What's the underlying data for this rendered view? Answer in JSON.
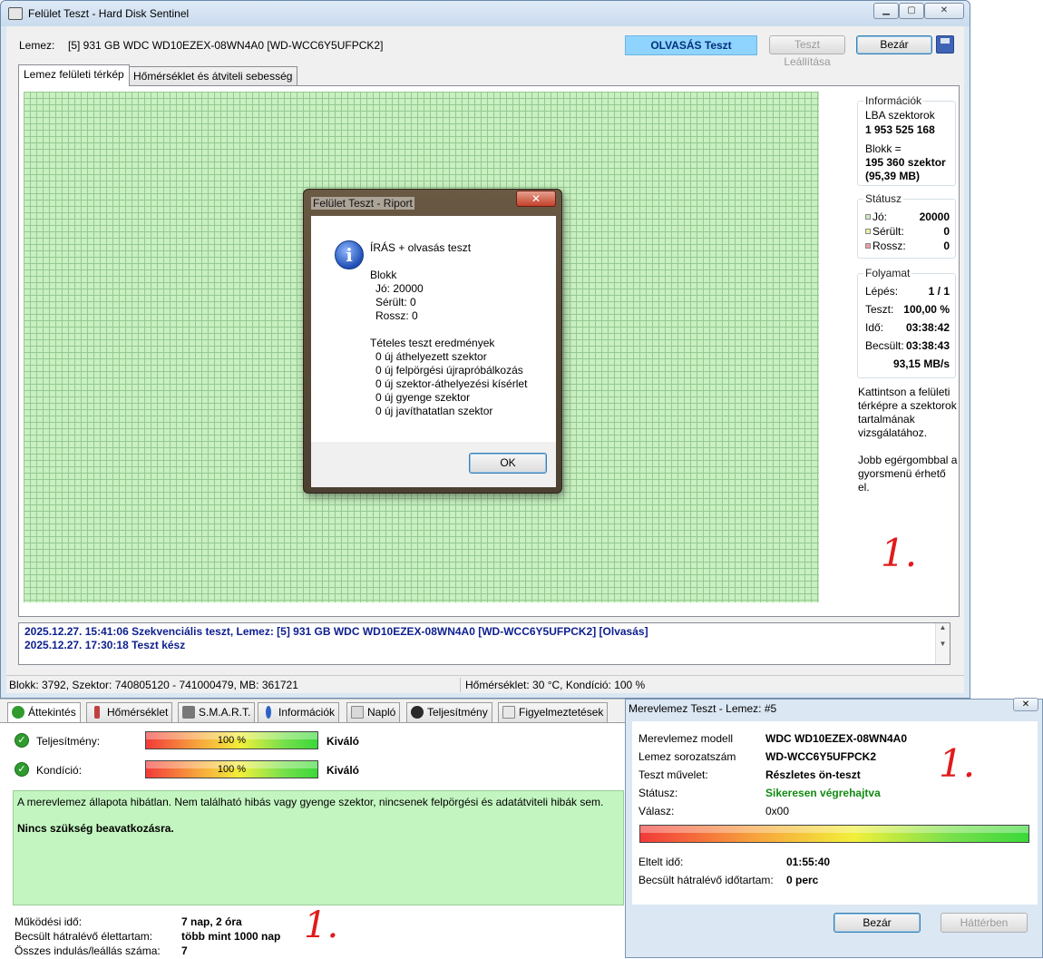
{
  "main_window": {
    "title": "Felület Teszt - Hard Disk Sentinel",
    "disk_label": "Lemez:",
    "disk_name": "[5] 931 GB  WDC WD10EZEX-08WN4A0 [WD-WCC6Y5UFPCK2]",
    "test_mode_badge": "OLVASÁS Teszt",
    "stop_button": "Teszt Leállítása",
    "close_button": "Bezár",
    "tabs": [
      "Lemez felületi térkép",
      "Hőmérséklet és átviteli sebesség"
    ],
    "info_group": {
      "title": "Információk",
      "lba_label": "LBA szektorok",
      "lba_value": "1 953 525 168",
      "block_label": "Blokk =",
      "block_value": "195 360 szektor",
      "block_mb": "(95,39 MB)"
    },
    "status_group": {
      "title": "Státusz",
      "good_label": "Jó:",
      "good_value": "20000",
      "damaged_label": "Sérült:",
      "damaged_value": "0",
      "bad_label": "Rossz:",
      "bad_value": "0",
      "colors": {
        "good": "#c8f0c0",
        "damaged": "#f0f0a0",
        "bad": "#f0a0a0"
      }
    },
    "progress_group": {
      "title": "Folyamat",
      "step_label": "Lépés:",
      "step_value": "1 / 1",
      "test_label": "Teszt:",
      "test_value": "100,00 %",
      "time_label": "Idő:",
      "time_value": "03:38:42",
      "estimated_label": "Becsült:",
      "estimated_value": "03:38:43",
      "speed_value": "93,15 MB/s"
    },
    "note_1": "Kattintson a felületi térképre a szektorok tartalmának vizsgálatához.",
    "note_2": "Jobb egérgombbal a gyorsmenü érhető el.",
    "log_lines": [
      "2025.12.27.  15:41:06   Szekvenciális teszt, Lemez: [5] 931 GB  WDC WD10EZEX-08WN4A0 [WD-WCC6Y5UFPCK2] [Olvasás]",
      "2025.12.27.  17:30:18   Teszt kész"
    ],
    "statusbar_left": "Blokk: 3792, Szektor: 740805120 - 741000479, MB: 361721",
    "statusbar_right": "Hőmérséklet: 30  °C,  Kondíció: 100 %"
  },
  "report_dialog": {
    "title": "Felület Teszt - Riport",
    "lines": [
      "ÍRÁS + olvasás teszt",
      "Blokk",
      "  Jó: 20000",
      "  Sérült: 0",
      "  Rossz: 0",
      "Tételes teszt eredmények",
      "  0 új áthelyezett szektor",
      "  0 új felpörgési újrapróbálkozás",
      "  0 új szektor-áthelyezési kísérlet",
      "  0 új gyenge szektor",
      "  0 új javíthatatlan szektor"
    ],
    "ok_button": "OK"
  },
  "overview": {
    "tabs": [
      "Áttekintés",
      "Hőmérséklet",
      "S.M.A.R.T.",
      "Információk",
      "Napló",
      "Teljesítmény",
      "Figyelmeztetések"
    ],
    "performance_label": "Teljesítmény:",
    "performance_value": "100 %",
    "performance_fraction": 1.0,
    "performance_rating": "Kiváló",
    "condition_label": "Kondíció:",
    "condition_value": "100 %",
    "condition_fraction": 1.0,
    "condition_rating": "Kiváló",
    "health_text": "A merevlemez állapota hibátlan. Nem található hibás vagy gyenge szektor, nincsenek felpörgési és adatátviteli hibák sem.",
    "health_action": "Nincs szükség beavatkozásra.",
    "power_on_label": "Működési idő:",
    "power_on_value": "7 nap, 2 óra",
    "lifetime_label": "Becsült hátralévő élettartam:",
    "lifetime_value": "több mint 1000 nap",
    "start_stop_label": "Összes indulás/leállás száma:",
    "start_stop_value": "7"
  },
  "selftest_window": {
    "title": "Merevlemez Teszt - Lemez: #5",
    "model_label": "Merevlemez modell",
    "model_value": "WDC WD10EZEX-08WN4A0",
    "serial_label": "Lemez sorozatszám",
    "serial_value": "WD-WCC6Y5UFPCK2",
    "operation_label": "Teszt művelet:",
    "operation_value": "Részletes ön-teszt",
    "status_label": "Státusz:",
    "status_value": "Sikeresen végrehajtva",
    "status_color": "#128a12",
    "response_label": "Válasz:",
    "response_value": "0x00",
    "progress_fraction": 1.0,
    "elapsed_label": "Eltelt idő:",
    "elapsed_value": "01:55:40",
    "remaining_label": "Becsült hátralévő időtartam:",
    "remaining_value": "0 perc",
    "close_button": "Bezár",
    "background_button": "Háttérben"
  },
  "handwritten_marks": [
    "1.",
    "1.",
    "1."
  ]
}
